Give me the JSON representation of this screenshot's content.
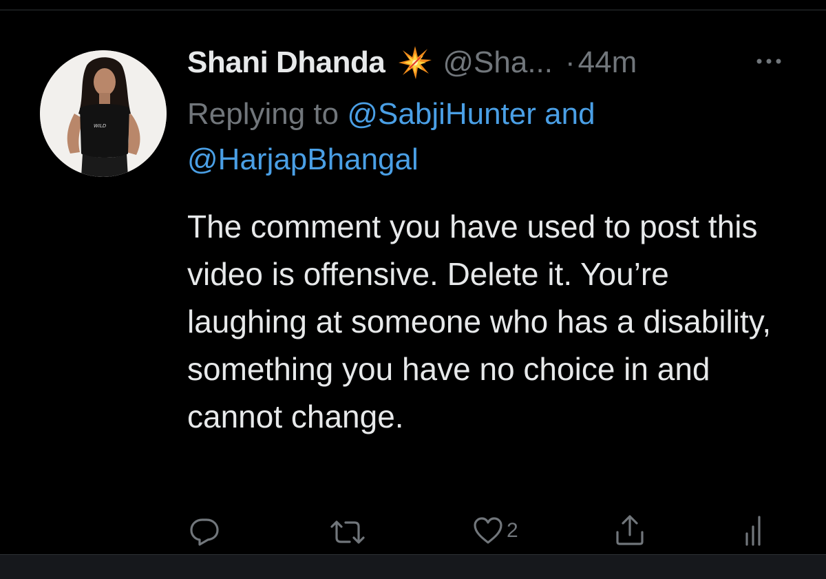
{
  "tweet": {
    "author": {
      "display_name": "Shani Dhanda",
      "name_emoji": "collision-icon",
      "handle": "@Sha...",
      "avatar": "avatar-photo",
      "avatar_shirt_text": "WILD"
    },
    "separator": "·",
    "time": "44m",
    "replying": {
      "prefix": "Replying to ",
      "mention_1": "@SabjiHunter",
      "conjunction": " and",
      "mention_2": "@HarjapBhangal"
    },
    "text": "The comment you have used to post this video is offensive. Delete it. You’re laughing at someone who has a disability, something you have no choice in and cannot change.",
    "actions": {
      "reply_icon": "reply-icon",
      "retweet_icon": "retweet-icon",
      "like_icon": "heart-icon",
      "like_count": "2",
      "share_icon": "share-icon",
      "analytics_icon": "analytics-icon"
    }
  },
  "colors": {
    "background": "#000000",
    "text_primary": "#e7e9ea",
    "text_secondary": "#71767b",
    "link": "#4a9fe5"
  }
}
